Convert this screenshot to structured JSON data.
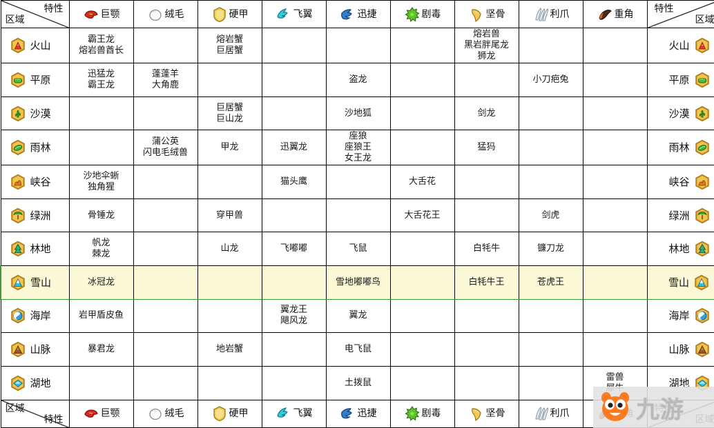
{
  "corners": {
    "top_left": {
      "upper": "特性",
      "lower": "区域"
    },
    "top_right": {
      "upper": "特性",
      "lower": "区域"
    },
    "bottom_left": {
      "upper": "区域",
      "lower": "特性"
    },
    "bottom_right": {
      "upper": "特性",
      "lower": "区域"
    }
  },
  "traits": [
    {
      "label": "巨颚",
      "icon": "jaw-icon",
      "color": "#d42a22"
    },
    {
      "label": "绒毛",
      "icon": "fluff-icon",
      "color": "#f2f2f2"
    },
    {
      "label": "硬甲",
      "icon": "shell-icon",
      "color": "#e8c84a"
    },
    {
      "label": "飞翼",
      "icon": "wing-icon",
      "color": "#35c8d8"
    },
    {
      "label": "迅捷",
      "icon": "swift-icon",
      "color": "#2f7fd0"
    },
    {
      "label": "剧毒",
      "icon": "poison-icon",
      "color": "#5ec22a"
    },
    {
      "label": "坚骨",
      "icon": "bone-icon",
      "color": "#f0c04a"
    },
    {
      "label": "利爪",
      "icon": "claw-icon",
      "color": "#dfe6ea"
    },
    {
      "label": "重角",
      "icon": "horn-icon",
      "color": "#d8601e"
    }
  ],
  "regions": [
    {
      "label": "火山",
      "icon": "volcano-icon"
    },
    {
      "label": "平原",
      "icon": "plains-icon"
    },
    {
      "label": "沙漠",
      "icon": "desert-icon"
    },
    {
      "label": "雨林",
      "icon": "rainforest-icon"
    },
    {
      "label": "峡谷",
      "icon": "canyon-icon"
    },
    {
      "label": "绿洲",
      "icon": "oasis-icon"
    },
    {
      "label": "林地",
      "icon": "woodland-icon"
    },
    {
      "label": "雪山",
      "icon": "snow-mountain-icon"
    },
    {
      "label": "海岸",
      "icon": "coast-icon"
    },
    {
      "label": "山脉",
      "icon": "mountain-icon"
    },
    {
      "label": "湖地",
      "icon": "lake-icon"
    }
  ],
  "highlighted_row": "雪山",
  "highlight_color": "#fbf8d8",
  "highlight_border_color": "#3d9b3d",
  "rows": [
    {
      "region": "火山",
      "cells": [
        "霸王龙\n熔岩兽酋长",
        "",
        "熔岩蟹\n巨居蟹",
        "",
        "",
        "",
        "熔岩兽\n黑岩胖尾龙\n狮龙",
        "",
        ""
      ]
    },
    {
      "region": "平原",
      "cells": [
        "迅猛龙\n霸王龙",
        "蓬蓬羊\n大角鹿",
        "",
        "",
        "盗龙",
        "",
        "",
        "小刀疤兔",
        ""
      ]
    },
    {
      "region": "沙漠",
      "cells": [
        "",
        "",
        "巨居蟹\n巨山龙",
        "",
        "沙地狐",
        "",
        "剑龙",
        "",
        ""
      ]
    },
    {
      "region": "雨林",
      "cells": [
        "",
        "蒲公英\n闪电毛绒兽",
        "甲龙",
        "迅翼龙",
        "座狼\n座狼王\n女王龙",
        "",
        "猛犸",
        "",
        ""
      ]
    },
    {
      "region": "峡谷",
      "cells": [
        "沙地伞蜥\n独角猩",
        "",
        "",
        "猫头鹰",
        "",
        "大舌花",
        "",
        "",
        ""
      ]
    },
    {
      "region": "绿洲",
      "cells": [
        "骨锤龙",
        "",
        "穿甲兽",
        "",
        "",
        "大舌花王",
        "",
        "剑虎",
        ""
      ]
    },
    {
      "region": "林地",
      "cells": [
        "帆龙\n棘龙",
        "",
        "山龙",
        "飞嘟嘟",
        "飞鼠",
        "",
        "白牦牛",
        "镰刀龙",
        ""
      ]
    },
    {
      "region": "雪山",
      "cells": [
        "冰冠龙",
        "",
        "",
        "",
        "雪地嘟嘟鸟",
        "",
        "白牦牛王",
        "苍虎王",
        ""
      ]
    },
    {
      "region": "海岸",
      "cells": [
        "岩甲盾皮鱼",
        "",
        "",
        "翼龙王\n飓风龙",
        "翼龙",
        "",
        "",
        "",
        ""
      ]
    },
    {
      "region": "山脉",
      "cells": [
        "暴君龙",
        "",
        "地岩蟹",
        "",
        "电飞鼠",
        "",
        "",
        "",
        ""
      ]
    },
    {
      "region": "湖地",
      "cells": [
        "",
        "",
        "",
        "",
        "土拨鼠",
        "",
        "",
        "",
        "雷兽\n犀牛"
      ]
    }
  ],
  "watermark": {
    "text": "九游",
    "logo": "mascot-logo"
  }
}
